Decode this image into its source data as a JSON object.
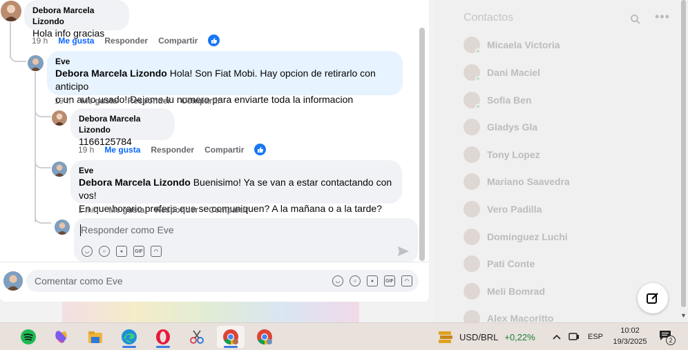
{
  "comments": {
    "top": {
      "author": "Debora Marcela Lizondo",
      "text": "Hola info gracias",
      "time": "19 h",
      "like": "Me gusta",
      "reply": "Responder",
      "share": "Compartir"
    },
    "reply1": {
      "author": "Eve",
      "mention": "Debora Marcela Lizondo",
      "text_line1": " Hola! Son Fiat Mobi. Hay opcion de retirarlo con anticipo",
      "text_line2": "o un auto usado! Dejame tu numero para enviarte toda la informacion",
      "time": "19 h",
      "like": "Me gusta",
      "reply": "Responder",
      "share": "Compartir"
    },
    "reply2": {
      "author": "Debora Marcela Lizondo",
      "text": "1166125784",
      "time": "19 h",
      "like": "Me gusta",
      "reply": "Responder",
      "share": "Compartir"
    },
    "reply3": {
      "author": "Eve",
      "mention": "Debora Marcela Lizondo",
      "text_line1": " Buenisimo! Ya se van a estar contactando con vos!",
      "text_line2": "En que horario preferis que se comuniquen? A la mañana o a la tarde?",
      "time": "1 min",
      "like": "Me gusta",
      "reply": "Responder",
      "share": "Compartir"
    }
  },
  "reply_box": {
    "placeholder": "Responder como Eve"
  },
  "comment_box": {
    "placeholder": "Comentar como Eve"
  },
  "contacts": {
    "title": "Contactos",
    "items": [
      {
        "name": "Micaela Victoria",
        "online": true
      },
      {
        "name": "Dani Maciel",
        "online": true
      },
      {
        "name": "Sofia Ben",
        "online": true
      },
      {
        "name": "Gladys Gla",
        "online": false
      },
      {
        "name": "Tony Lopez",
        "online": false
      },
      {
        "name": "Mariano Saavedra",
        "online": false
      },
      {
        "name": "Vero Padilla",
        "online": false
      },
      {
        "name": "Dominguez Luchi",
        "online": false
      },
      {
        "name": "Pati Conte",
        "online": false
      },
      {
        "name": "Meli Bomrad",
        "online": false
      },
      {
        "name": "Alex Macoritto",
        "online": false
      }
    ]
  },
  "taskbar": {
    "apps": [
      "spotify-icon",
      "copilot-icon",
      "file-explorer-icon",
      "edge-icon",
      "opera-icon",
      "snipping-tool-icon",
      "chrome-icon",
      "chrome-profile-icon"
    ],
    "ticker_label": "USD/BRL",
    "ticker_change": "+0,22%",
    "language": "ESP",
    "time": "10:02",
    "date": "19/3/2025",
    "notification_count": "2"
  },
  "colors": {
    "facebook_blue": "#0866ff",
    "bubble_gray": "#f0f2f5",
    "bubble_blue": "#e7f3ff",
    "ticker_positive": "#1a7f37"
  }
}
